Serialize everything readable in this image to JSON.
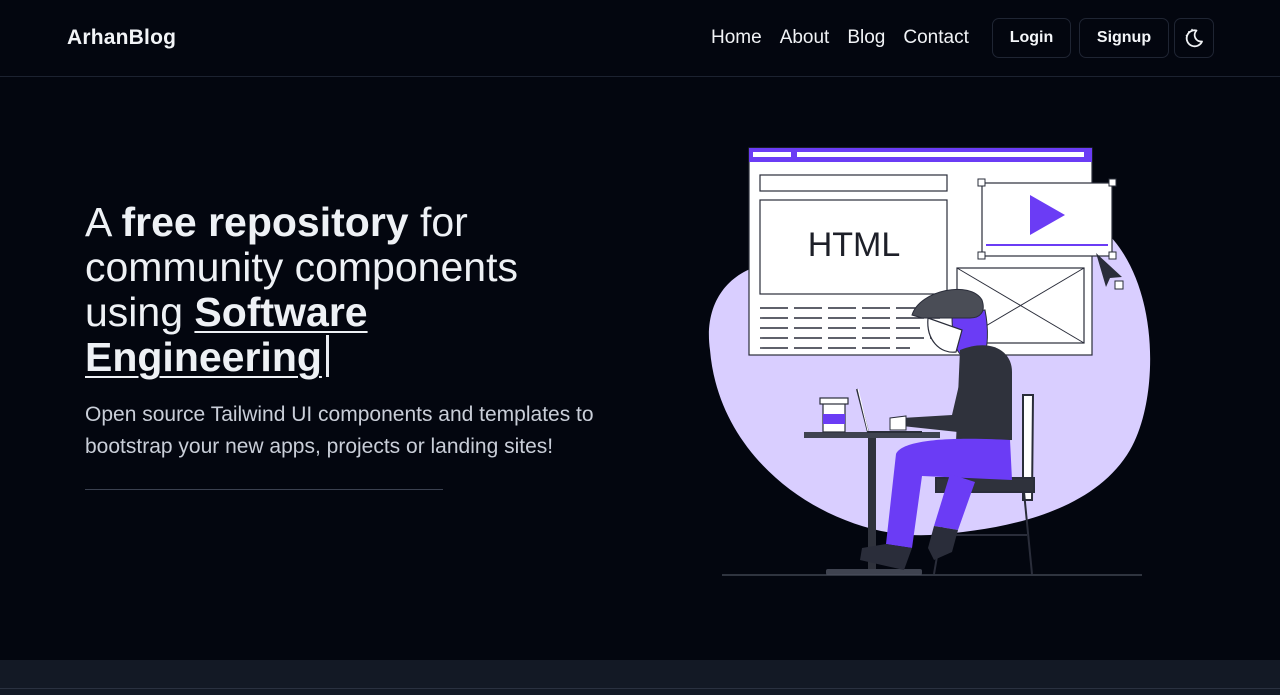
{
  "navbar": {
    "brand": "ArhanBlog",
    "links": [
      "Home",
      "About",
      "Blog",
      "Contact"
    ],
    "login_label": "Login",
    "signup_label": "Signup",
    "theme_icon": "moon-icon"
  },
  "hero": {
    "title_prefix": "A ",
    "title_strong": "free repository",
    "title_middle": " for community components using ",
    "title_highlight": "Software Engineering",
    "subtitle": "Open source Tailwind UI components and templates to bootstrap your new apps, projects or landing sites!"
  },
  "illustration": {
    "html_label": "HTML",
    "icons": [
      "play-icon",
      "cursor-icon",
      "coffee-cup-icon",
      "laptop-icon"
    ]
  },
  "colors": {
    "background": "#03060f",
    "accent": "#6b3cf5",
    "blob": "#d9ceff",
    "footer": "#131925"
  }
}
